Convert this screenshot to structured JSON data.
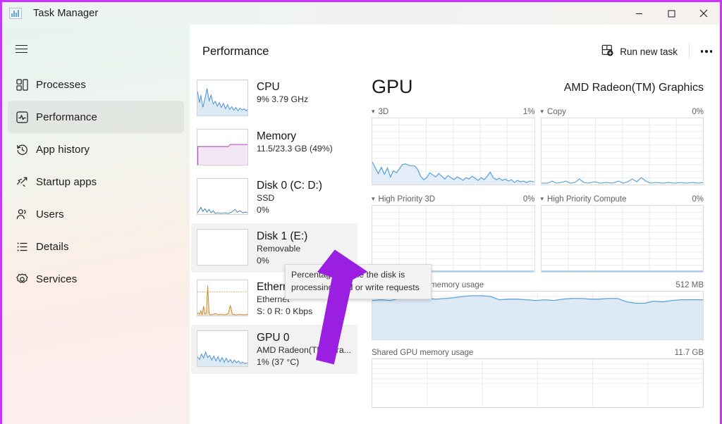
{
  "window": {
    "title": "Task Manager",
    "app_icon": "chart-icon",
    "controls": {
      "minimize": "minimize-icon",
      "maximize": "maximize-icon",
      "close": "close-icon"
    },
    "border_color": "#cc33ff"
  },
  "sidebar": {
    "menu_icon": "hamburger-icon",
    "items": [
      {
        "label": "Processes",
        "icon": "processes-icon",
        "selected": false
      },
      {
        "label": "Performance",
        "icon": "performance-icon",
        "selected": true
      },
      {
        "label": "App history",
        "icon": "history-icon",
        "selected": false
      },
      {
        "label": "Startup apps",
        "icon": "startup-icon",
        "selected": false
      },
      {
        "label": "Users",
        "icon": "users-icon",
        "selected": false
      },
      {
        "label": "Details",
        "icon": "details-icon",
        "selected": false
      },
      {
        "label": "Services",
        "icon": "services-icon",
        "selected": false
      }
    ]
  },
  "toolbar": {
    "title": "Performance",
    "run_new_task": "Run new task",
    "run_new_task_icon": "new-task-icon",
    "more_options_icon": "ellipsis-icon"
  },
  "device_list": [
    {
      "name": "CPU",
      "line1": "9% 3.79 GHz",
      "line2": "",
      "color": "#4a90d9",
      "selected": false
    },
    {
      "name": "Memory",
      "line1": "11.5/23.3 GB (49%)",
      "line2": "",
      "color": "#b44ac0",
      "selected": false
    },
    {
      "name": "Disk 0 (C: D:)",
      "line1": "SSD",
      "line2": "0%",
      "color": "#3e7fb5",
      "selected": false
    },
    {
      "name": "Disk 1 (E:)",
      "line1": "Removable",
      "line2": "0%",
      "color": "#3e7fb5",
      "selected": true
    },
    {
      "name": "Ethernet",
      "line1": "Ethernet",
      "line2": "S: 0 R: 0 Kbps",
      "color": "#c98a2e",
      "selected": false
    },
    {
      "name": "GPU 0",
      "line1": "AMD Radeon(TM) Gra...",
      "line2": "1%  (37 °C)",
      "color": "#4a90d9",
      "selected": true
    }
  ],
  "gpu_panel": {
    "title": "GPU",
    "model": "AMD Radeon(TM) Graphics",
    "graphs": [
      {
        "label": "3D",
        "value": "1%",
        "chevron": "chevron-down-icon"
      },
      {
        "label": "Copy",
        "value": "0%",
        "chevron": "chevron-down-icon"
      },
      {
        "label": "High Priority 3D",
        "value": "0%",
        "chevron": "chevron-down-icon"
      },
      {
        "label": "High Priority Compute",
        "value": "0%",
        "chevron": "chevron-down-icon"
      }
    ],
    "memory": [
      {
        "label": "Dedicated GPU memory usage",
        "value": "512 MB"
      },
      {
        "label": "Shared GPU memory usage",
        "value": "11.7 GB"
      }
    ]
  },
  "tooltip": {
    "text": "Percentage of time the disk is processing read or write requests"
  },
  "annotation": {
    "arrow_color": "#9b1fe0"
  }
}
